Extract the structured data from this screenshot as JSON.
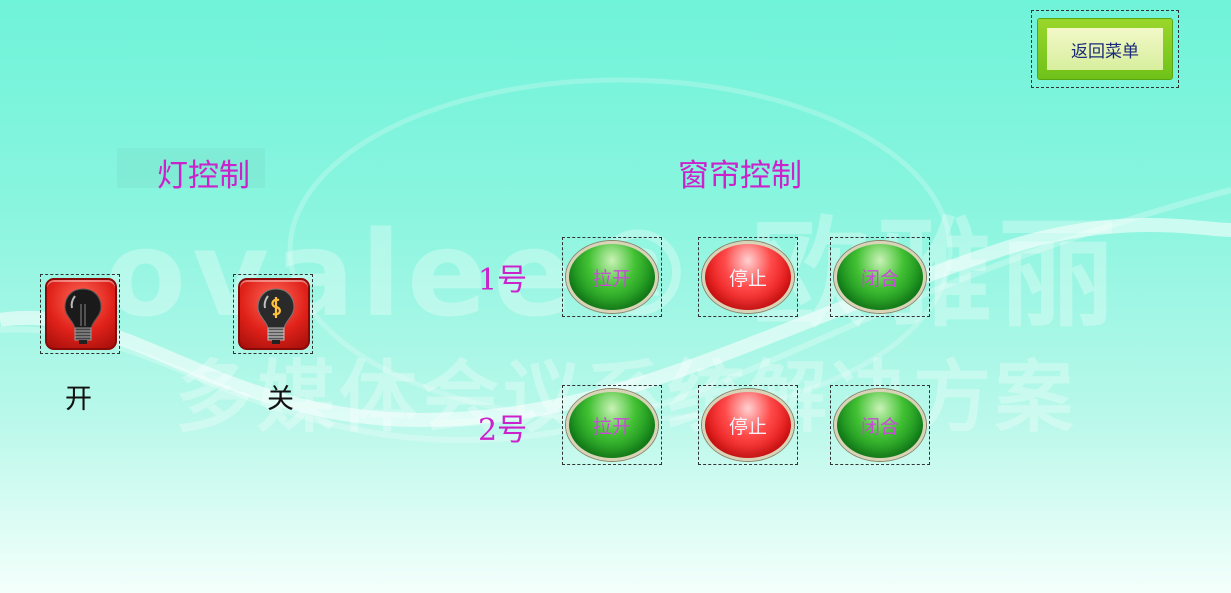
{
  "menu": {
    "back_label": "返回菜单"
  },
  "watermark": {
    "brand": "ovalee® 欧雅丽",
    "slogan": "多媒体会议系统解决方案"
  },
  "light": {
    "title": "灯控制",
    "on_label": "开",
    "off_label": "关"
  },
  "curtain": {
    "title": "窗帘控制",
    "rows": [
      {
        "label": "1号",
        "open": "拉开",
        "stop": "停止",
        "close": "闭合"
      },
      {
        "label": "2号",
        "open": "拉开",
        "stop": "停止",
        "close": "闭合"
      }
    ]
  },
  "colors": {
    "title": "#cc22cc",
    "button_text": "#c84bd8",
    "green": "#2eaa2a",
    "red": "#e11414"
  }
}
